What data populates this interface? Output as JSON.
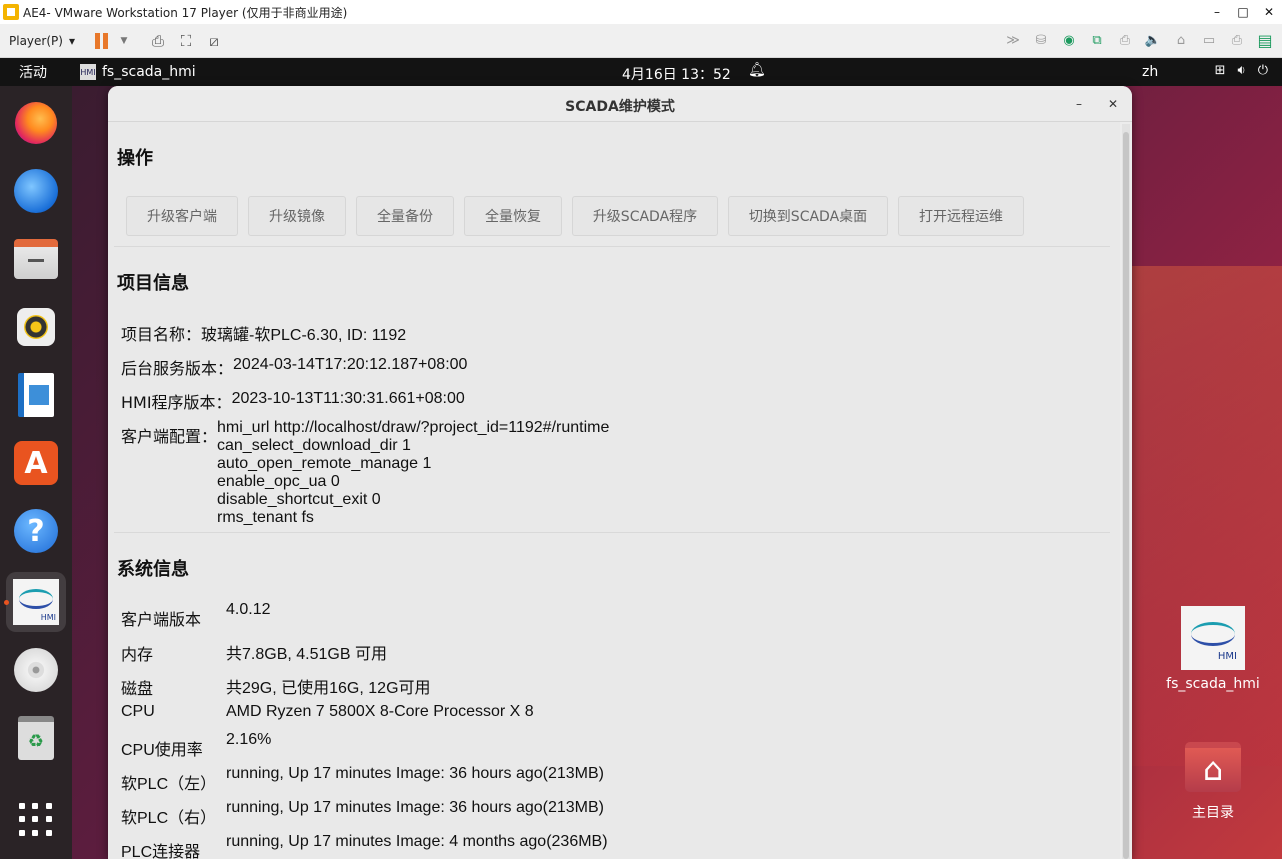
{
  "vm": {
    "title": "AE4- VMware Workstation 17 Player (仅用于非商业用途)",
    "player_menu": "Player(P)",
    "win_buttons": [
      "–",
      "□",
      "✕"
    ]
  },
  "gnome": {
    "activities": "活动",
    "app_name": "fs_scada_hmi",
    "clock": "4月16日  13：52",
    "lang": "zh"
  },
  "window": {
    "title": "SCADA维护模式",
    "minimize": "–",
    "close": "✕"
  },
  "operations": {
    "title": "操作",
    "buttons": [
      "升级客户端",
      "升级镜像",
      "全量备份",
      "全量恢复",
      "升级SCADA程序",
      "切换到SCADA桌面",
      "打开远程运维"
    ]
  },
  "project": {
    "title": "项目信息",
    "name_label": "项目名称：",
    "name_value": "玻璃罐-软PLC-6.30, ID: 1192",
    "backend_label": "后台服务版本：",
    "backend_value": "2024-03-14T17:20:12.187+08:00",
    "hmi_label": "HMI程序版本：",
    "hmi_value": "2023-10-13T11:30:31.661+08:00",
    "client_cfg_label": "客户端配置：",
    "client_cfg": [
      "hmi_url   http://localhost/draw/?project_id=1192#/runtime",
      "can_select_download_dir   1",
      "auto_open_remote_manage   1",
      "enable_opc_ua   0",
      "disable_shortcut_exit   0",
      "rms_tenant   fs"
    ]
  },
  "system": {
    "title": "系统信息",
    "rows": [
      {
        "label": "客户端版本",
        "value": "4.0.12"
      },
      {
        "label": "内存",
        "value": "共7.8GB, 4.51GB 可用"
      },
      {
        "label": "磁盘",
        "value": "共29G, 已使用16G, 12G可用"
      },
      {
        "label": "CPU",
        "value": "AMD Ryzen 7 5800X 8-Core Processor X 8"
      },
      {
        "label": "CPU使用率",
        "value": "2.16%"
      },
      {
        "label": "软PLC（左）",
        "value": "running, Up 17 minutes Image: 36 hours ago(213MB)"
      },
      {
        "label": "软PLC（右）",
        "value": "running, Up 17 minutes Image: 36 hours ago(213MB)"
      },
      {
        "label": "PLC连接器",
        "value": "running, Up 17 minutes Image: 4 months ago(236MB)"
      }
    ]
  },
  "desktop": {
    "hmi_icon_label": "fs_scada_hmi",
    "hmi_badge": "HMI",
    "home_icon_label": "主目录"
  },
  "dock": {
    "hmi_badge": "HMI",
    "store_glyph": "A",
    "help_glyph": "?"
  }
}
